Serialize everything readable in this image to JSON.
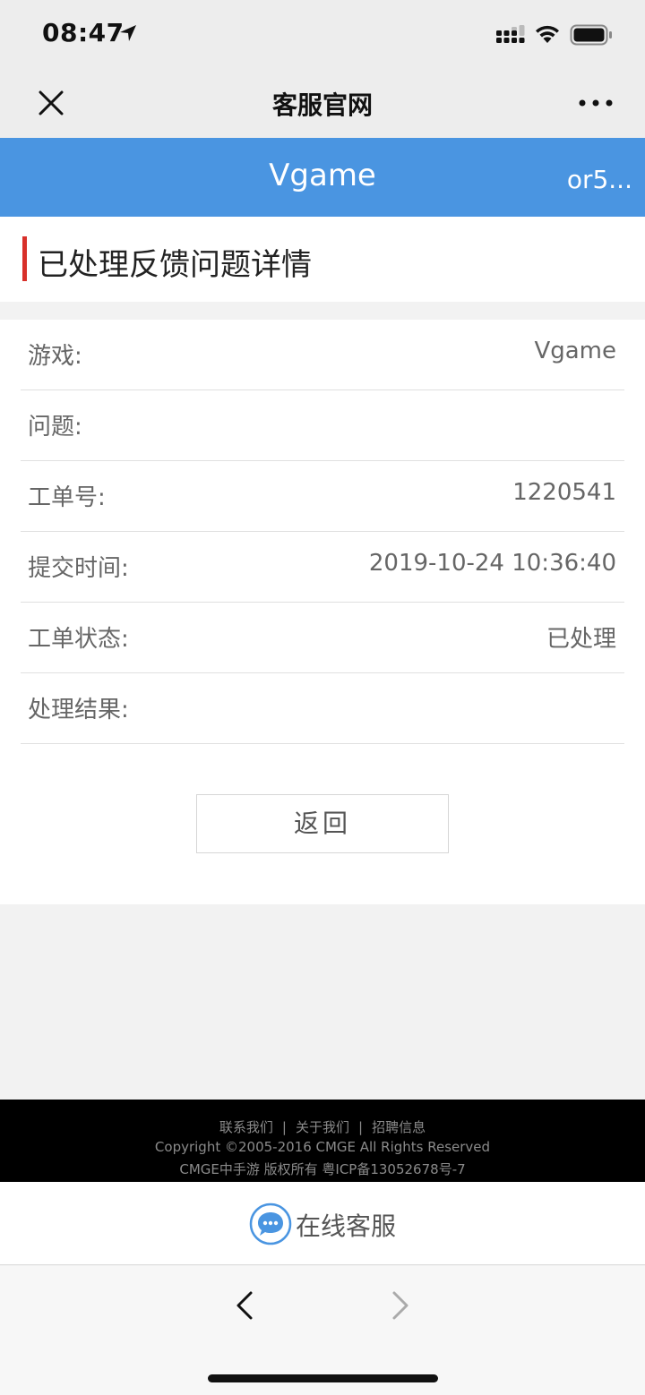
{
  "status_bar": {
    "time": "08:47"
  },
  "wechat_nav": {
    "title": "客服官网"
  },
  "header": {
    "title": "Vgame",
    "right_text": "or5..."
  },
  "section": {
    "title": "已处理反馈问题详情"
  },
  "details": [
    {
      "label": "游戏:",
      "value": "Vgame"
    },
    {
      "label": "问题:",
      "value": ""
    },
    {
      "label": "工单号:",
      "value": "1220541"
    },
    {
      "label": "提交时间:",
      "value": "2019-10-24 10:36:40"
    },
    {
      "label": "工单状态:",
      "value": "已处理"
    },
    {
      "label": "处理结果:",
      "value": ""
    }
  ],
  "back_button": {
    "label": "返回"
  },
  "footer": {
    "links": [
      "联系我们",
      "关于我们",
      "招聘信息"
    ],
    "copyright": "Copyright ©2005-2016 CMGE All Rights Reserved",
    "icp": "CMGE中手游 版权所有 粤ICP备13052678号-7"
  },
  "online_service": {
    "label": "在线客服"
  },
  "colors": {
    "header_blue": "#4a95e1",
    "accent_red": "#d8302a",
    "footer_bg": "#000000",
    "chat_icon_blue": "#4a95e1"
  },
  "icons": [
    "location-arrow-icon",
    "cellular-signal-icon",
    "wifi-icon",
    "battery-icon",
    "close-icon",
    "more-icon",
    "chat-bubble-icon",
    "chevron-left-icon",
    "chevron-right-icon"
  ]
}
